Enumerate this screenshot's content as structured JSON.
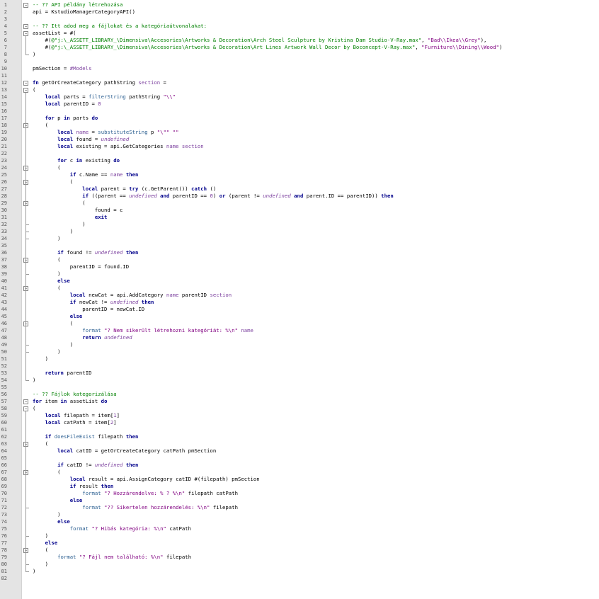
{
  "editor": {
    "lines": [
      "-- ?? API példány létrehozása",
      "api = KstudioManagerCategoryAPI()",
      "",
      "-- ?? Itt adod meg a fájlokat és a kategóriaútvonalakat:",
      "assetList = #(",
      "    #(@\"j:\\_ASSETT_LIBRARY_\\Dimensiva\\Accesories\\Artworks & Decoration\\Arch Steel Sculpture by Kristina Dam Studio-V-Ray.max\", \"Bad\\\\Ikea\\\\Grey\"),",
      "    #(@\"j:\\_ASSETT_LIBRARY_\\Dimensiva\\Accesories\\Artworks & Decoration\\Art Lines Artwork Wall Decor by Boconcept-V-Ray.max\", \"Furniture\\\\Dining\\\\Wood\")",
      ")",
      "",
      "pmSection = #Models",
      "",
      "fn getOrCreateCategory pathString section =",
      "(",
      "    local parts = filterString pathString \"\\\\\"",
      "    local parentID = 0",
      "",
      "    for p in parts do",
      "    (",
      "        local name = substituteString p \"\\\"\" \"\"",
      "        local found = undefined",
      "        local existing = api.GetCategories name section",
      "",
      "        for c in existing do",
      "        (",
      "            if c.Name == name then",
      "            (",
      "                local parent = try (c.GetParent()) catch ()",
      "                if ((parent == undefined and parentID == 0) or (parent != undefined and parent.ID == parentID)) then",
      "                (",
      "                    found = c",
      "                    exit",
      "                )",
      "            )",
      "        )",
      "",
      "        if found != undefined then",
      "        (",
      "            parentID = found.ID",
      "        )",
      "        else",
      "        (",
      "            local newCat = api.AddCategory name parentID section",
      "            if newCat != undefined then",
      "                parentID = newCat.ID",
      "            else",
      "            (",
      "                format \"? Nem sikerült létrehozni kategóriát: %\\n\" name",
      "                return undefined",
      "            )",
      "        )",
      "    )",
      "",
      "    return parentID",
      ")",
      "",
      "-- ?? Fájlok kategorizálása",
      "for item in assetList do",
      "(",
      "    local filepath = item[1]",
      "    local catPath = item[2]",
      "",
      "    if doesFileExist filepath then",
      "    (",
      "        local catID = getOrCreateCategory catPath pmSection",
      "",
      "        if catID != undefined then",
      "        (",
      "            local result = api.AssignCategory catID #(filepath) pmSection",
      "            if result then",
      "                format \"? Hozzárendelve: % ? %\\n\" filepath catPath",
      "            else",
      "                format \"?? Sikertelen hozzárendelés: %\\n\" filepath",
      "        )",
      "        else",
      "            format \"? Hibás kategória: %\\n\" catPath",
      "    )",
      "    else",
      "    (",
      "        format \"? Fájl nem található: %\\n\" filepath",
      "    )",
      ")",
      ""
    ],
    "fold_lines": [
      1,
      4,
      5,
      12,
      13,
      18,
      24,
      26,
      29,
      37,
      41,
      46,
      57,
      58,
      63,
      67,
      78
    ]
  }
}
